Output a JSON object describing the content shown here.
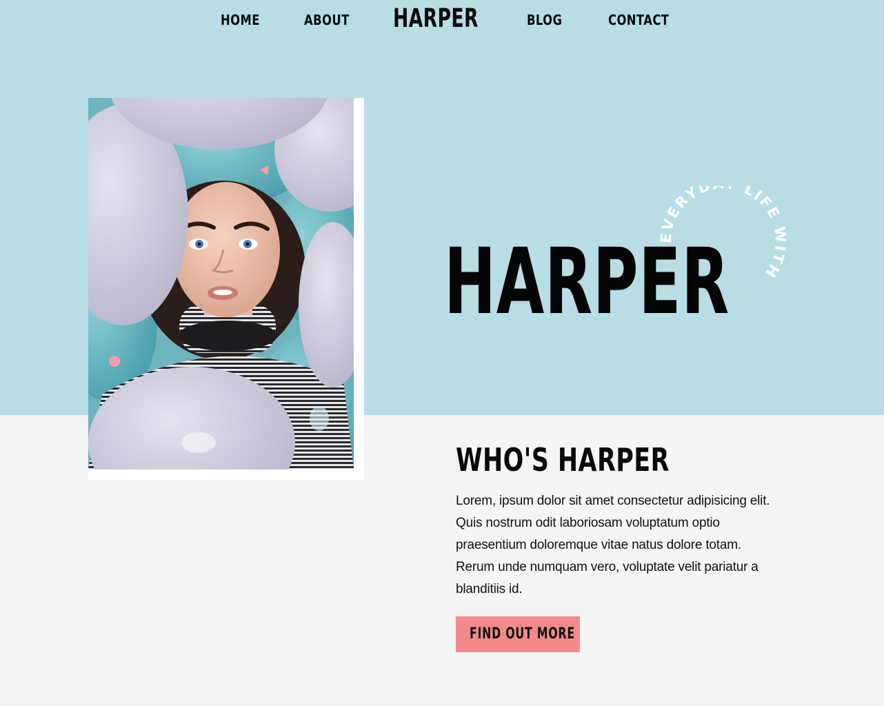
{
  "nav": {
    "home": "HOME",
    "about": "ABOUT",
    "brand": "HARPER",
    "blog": "BLOG",
    "contact": "CONTACT"
  },
  "hero": {
    "title": "HARPER",
    "curved_text": "EVERYDAY LIFE WITH"
  },
  "about": {
    "title": "WHO'S HARPER",
    "body": "Lorem, ipsum dolor sit amet consectetur adipisicing elit. Quis nostrum odit laboriosam voluptatum optio praesentium doloremque vitae natus dolore totam. Rerum unde numquam vero, voluptate velit pariatur a blanditiis id.",
    "cta_label": "FIND OUT MORE"
  },
  "colors": {
    "hero_bg": "#b8dde5",
    "page_bg": "#f5f5f5",
    "cta_bg": "#f18b8b",
    "text": "#0a0a0a"
  }
}
